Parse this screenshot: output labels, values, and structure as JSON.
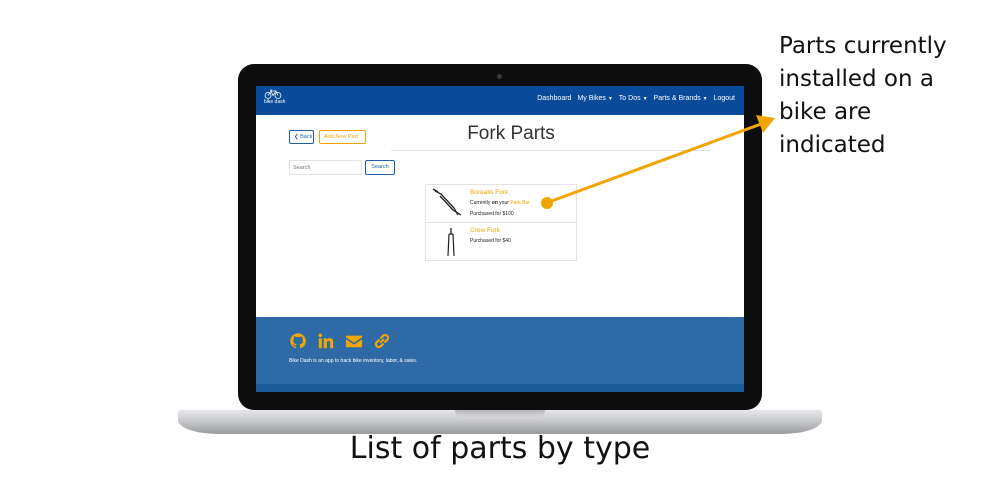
{
  "navbar": {
    "brand": "bike dash",
    "links": [
      "Dashboard",
      "My Bikes",
      "To Dos",
      "Parts & Brands",
      "Logout"
    ],
    "dropdown_links": [
      "My Bikes",
      "To Dos",
      "Parts & Brands"
    ]
  },
  "toolbar": {
    "back_label": "Back",
    "add_label": "Add New Part"
  },
  "page": {
    "title": "Fork Parts"
  },
  "search": {
    "placeholder": "Search",
    "button_label": "Search"
  },
  "parts": [
    {
      "name": "Borealis Fork",
      "status_prefix": "Currently ",
      "status_emphasis": "on",
      "status_mid": " your ",
      "bike": "Park Bar",
      "purchased": "Purchased for $100",
      "icon": "fork-icon"
    },
    {
      "name": "Crew Fork",
      "purchased": "Purchased for $40",
      "icon": "fork-icon"
    }
  ],
  "footer": {
    "icons": [
      "github-icon",
      "linkedin-icon",
      "envelope-icon",
      "link-icon"
    ],
    "text": "Bike Dash is an app to track bike inventory, labor, & sales."
  },
  "annotation": {
    "lines": [
      "Parts currently",
      "installed on a",
      "bike are",
      "indicated"
    ]
  },
  "caption": "List of parts by type",
  "colors": {
    "navbar": "#0a4a9a",
    "accent": "#f0a500",
    "footer": "#2e6aa6",
    "button_border": "#1f5fa8"
  }
}
